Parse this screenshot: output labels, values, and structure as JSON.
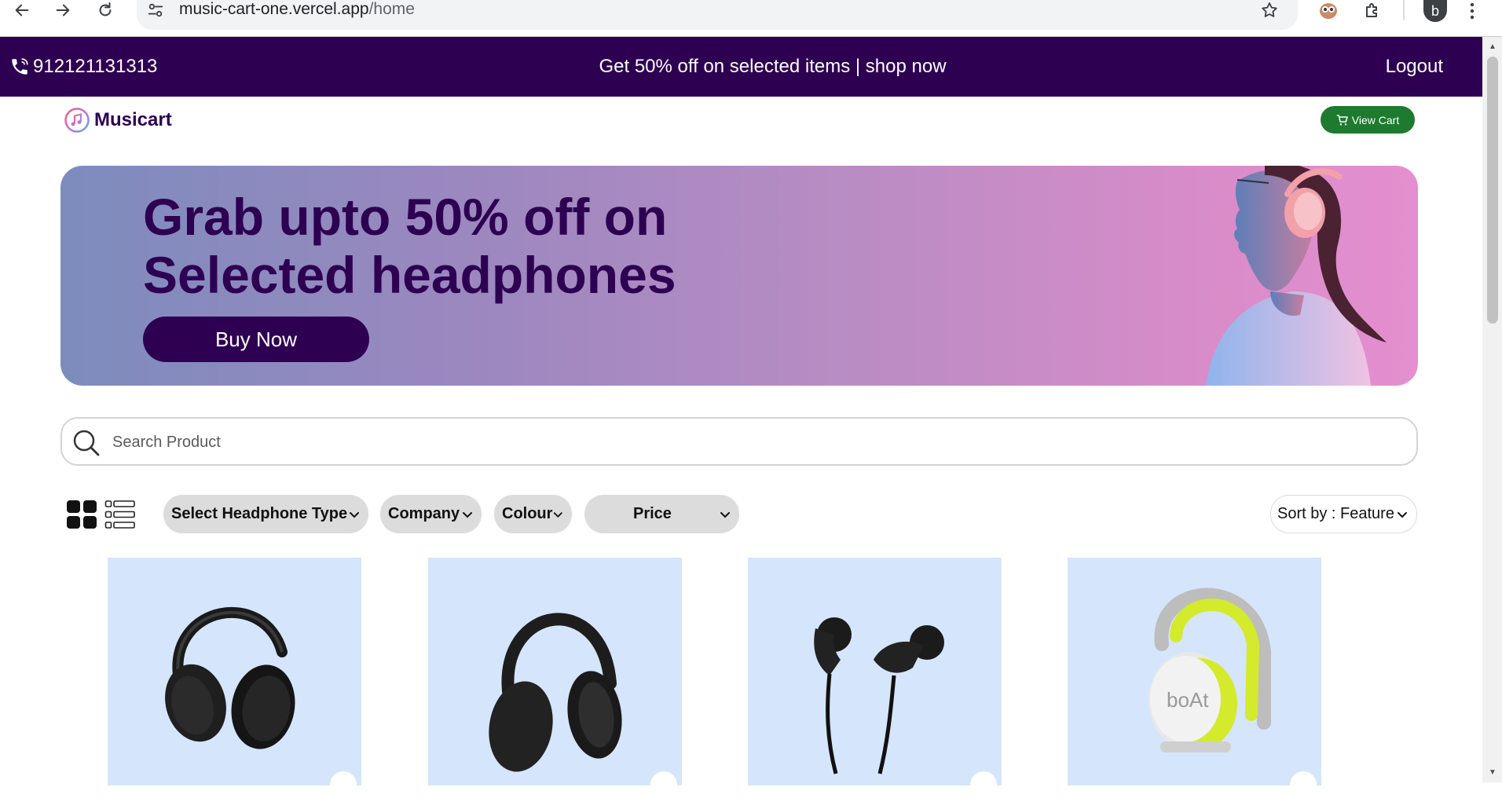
{
  "browser": {
    "url_host": "music-cart-one.vercel.app",
    "url_path": "/home",
    "profile_initial": "b"
  },
  "topbar": {
    "phone": "912121131313",
    "promo_text": "Get 50% off on selected items",
    "promo_separator": "|",
    "promo_link": "shop now",
    "logout_label": "Logout"
  },
  "header": {
    "logo_text": "Musicart",
    "view_cart_label": "View Cart"
  },
  "banner": {
    "line1": "Grab upto 50% off on",
    "line2": "Selected headphones",
    "button_label": "Buy Now"
  },
  "search": {
    "placeholder": "Search Product",
    "value": ""
  },
  "filters": {
    "headphone_type": "Select Headphone Type",
    "company": "Company",
    "colour": "Colour",
    "price": "Price",
    "sort": "Sort by : Feature"
  },
  "products": [
    {
      "image": "black-over-ear-headphones"
    },
    {
      "image": "sony-black-headphones"
    },
    {
      "image": "jbl-in-ear-earphones"
    },
    {
      "image": "boat-yellow-headphones",
      "brand_mark": "boAt"
    }
  ],
  "colors": {
    "topbar": "#2e0052",
    "brand_purple": "#2e0052",
    "cart_green": "#1d7a2e",
    "product_bg": "#d5e5fb",
    "pill_bg": "#dcdcdc"
  }
}
